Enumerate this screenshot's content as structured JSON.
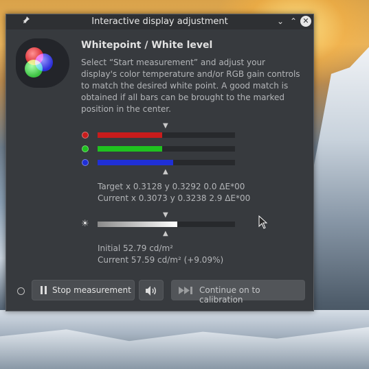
{
  "window": {
    "title": "Interactive display adjustment",
    "pin_icon": "pin-icon",
    "minimize_symbol": "⌄",
    "maximize_symbol": "⌃",
    "close_symbol": "✕"
  },
  "section": {
    "heading": "Whitepoint / White level",
    "description": "Select “Start measurement” and adjust your display's color temperature and/or RGB gain controls to match the desired white point. A good match is obtained if all bars can be brought to the marked position in the center."
  },
  "rgb_bars": [
    {
      "channel": "red",
      "color": "#c91c1c",
      "level": 0.47
    },
    {
      "channel": "green",
      "color": "#1fc21f",
      "level": 0.47
    },
    {
      "channel": "blue",
      "color": "#1f2fd6",
      "level": 0.55
    }
  ],
  "whitepoint": {
    "target": "Target x 0.3128 y 0.3292 0.0 ΔE*00",
    "current": "Current x 0.3073 y 0.3238 2.9 ΔE*00"
  },
  "luminance": {
    "level": 0.58,
    "initial": "Initial 52.79 cd/m²",
    "current": "Current 57.59 cd/m² (+9.09%)"
  },
  "buttons": {
    "stop_label": "Stop measurement",
    "continue_label": "Continue on to calibration",
    "pause_icon": "pause-icon",
    "speaker_icon": "speaker-icon",
    "skip_icon": "skip-forward-icon"
  },
  "colors": {
    "window_bg": "#373a3e",
    "titlebar_bg": "#2e3033"
  }
}
